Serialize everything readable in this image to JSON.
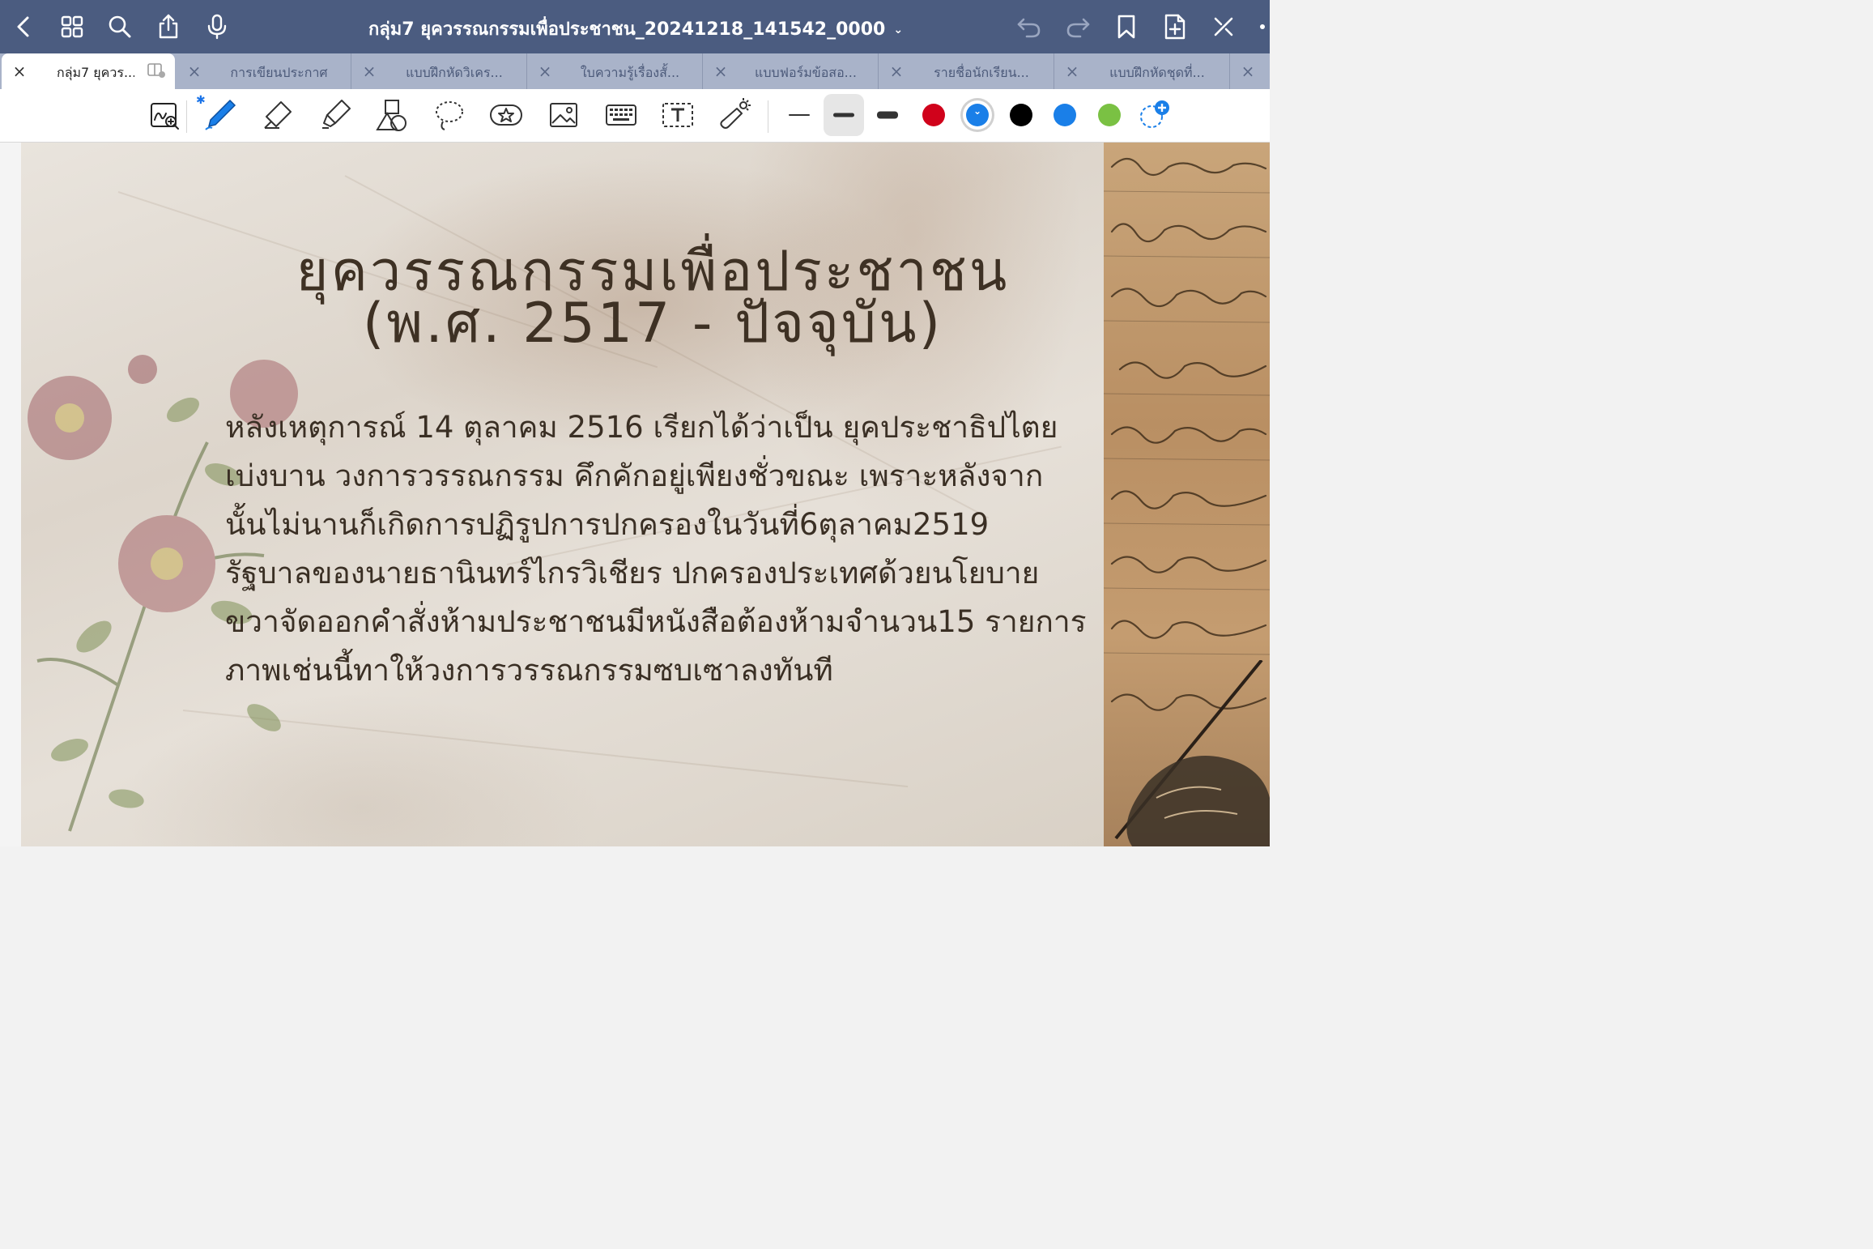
{
  "titlebar": {
    "doc_title": "กลุ่ม7 ยุควรรณกรรมเพื่อประชาชน_20241218_141542_0000",
    "icons": [
      "back-icon",
      "grid-icon",
      "search-icon",
      "share-icon",
      "microphone-icon",
      "undo-icon",
      "redo-icon",
      "bookmark-icon",
      "add-page-icon",
      "close-toolbar-icon"
    ]
  },
  "tabs": [
    {
      "label": "กลุ่ม7 ยุควร...",
      "active": true
    },
    {
      "label": "การเขียนประกาศ"
    },
    {
      "label": "แบบฝึกหัดวิเคร..."
    },
    {
      "label": "ใบความรู้เรื่องสั้..."
    },
    {
      "label": "แบบฟอร์มข้อสอ..."
    },
    {
      "label": "รายชื่อนักเรียน..."
    },
    {
      "label": "แบบฝึกหัดชุดที่..."
    }
  ],
  "toolbar": {
    "tools": [
      "handwriting-search-icon",
      "pen-icon",
      "eraser-icon",
      "highlighter-icon",
      "shapes-icon",
      "lasso-icon",
      "stickers-icon",
      "image-icon",
      "keyboard-icon",
      "text-box-icon",
      "laser-pointer-icon"
    ],
    "pen_sizes": [
      "thin",
      "medium",
      "thick"
    ],
    "selected_size": "medium",
    "colors": [
      "#d0021b",
      "#1a7fe8",
      "#000000",
      "#1a7fe8",
      "#7ac143"
    ],
    "selected_color_index": 1,
    "bluetooth_glyph": "✱"
  },
  "page": {
    "heading_line1": "ยุควรรณกรรมเพื่อประชาชน",
    "heading_line2": "(พ.ศ. 2517 - ปัจจุบัน)",
    "body_lines": [
      "หลังเหตุการณ์ 14 ตุลาคม 2516 เรียกได้ว่าเป็น ยุคประชาธิปไตย",
      "เบ่งบาน วงการวรรณกรรม คึกคักอยู่เพียงชั่วขณะ เพราะหลังจาก",
      "นั้นไม่นานก็เกิดการปฏิรูปการปกครองในวันที่6ตุลาคม2519",
      "รัฐบาลของนายธานินทร์ไกรวิเชียร   ปกครองประเทศด้วยนโยบาย",
      "ขวาจัดออกคำสั่งห้ามประชาชนมีหนังสือต้องห้ามจำนวน15 รายการ",
      "ภาพเช่นนี้ทาให้วงการวรรณกรรมซบเซาลงทันที"
    ]
  }
}
